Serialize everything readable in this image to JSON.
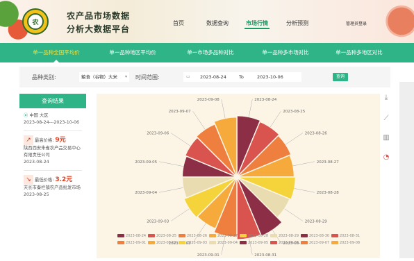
{
  "brand": {
    "line1": "农产品市场数据",
    "line2": "分析大数据平台",
    "logo_text": "农"
  },
  "nav": [
    {
      "label": "首页"
    },
    {
      "label": "数据查询"
    },
    {
      "label": "市场行情"
    },
    {
      "label": "分析预测"
    }
  ],
  "nav_active_index": 2,
  "login_label": "管理员登录",
  "subnav": [
    {
      "label": "单一品种全国平均价"
    },
    {
      "label": "单一品种地区平均价"
    },
    {
      "label": "单一市场多品种对比"
    },
    {
      "label": "单一品种多市场对比"
    },
    {
      "label": "单一品种多地区对比"
    }
  ],
  "filter": {
    "category_label": "品种类别:",
    "category_value": "粮食（谷物）大米",
    "time_label": "时间范围:",
    "date_from": "2023-08-24",
    "to_label": "To",
    "date_to": "2023-10-06",
    "search_label": "查询"
  },
  "sidebar": {
    "title": "查询结果",
    "region": "中国 大区",
    "date_range": "2023-08-24---2023-10-06",
    "max_label": "最高价格:",
    "max_value": "9元",
    "max_market": "陕西西安朱雀农产品交易中心有限责任公司",
    "max_date": "2023-08-24",
    "min_label": "最低价格:",
    "min_value": "3.2元",
    "min_market": "天长市秦栏镇农产品批发市场",
    "min_date": "2023-08-25"
  },
  "chart_data": {
    "type": "pie",
    "subtype": "rose",
    "categories": [
      "2023-08-24",
      "2023-08-25",
      "2023-08-26",
      "2023-08-27",
      "2023-08-28",
      "2023-08-29",
      "2023-08-30",
      "2023-08-31",
      "2023-09-01",
      "2023-09-02",
      "2023-09-03",
      "2023-09-04",
      "2023-09-05",
      "2023-09-06",
      "2023-09-07",
      "2023-09-08"
    ],
    "values": [
      5,
      5,
      5,
      5,
      5,
      5,
      5,
      5,
      5,
      5,
      5,
      5,
      5,
      5,
      5,
      5
    ],
    "radii": [
      0.92,
      0.9,
      0.88,
      0.86,
      0.88,
      0.86,
      0.96,
      0.94,
      0.9,
      0.84,
      0.86,
      0.82,
      0.82,
      0.84,
      0.86,
      0.9
    ],
    "colors": [
      "#8b2e46",
      "#d9534f",
      "#ee7f3e",
      "#f6aa3b",
      "#f4d43a",
      "#e8dcb0",
      "#8b2e46",
      "#d9534f",
      "#ee7f3e",
      "#f6aa3b",
      "#f4d43a",
      "#e8dcb0",
      "#8b2e46",
      "#d9534f",
      "#ee7f3e",
      "#f6aa3b"
    ],
    "legend": [
      "2023-08-24",
      "2023-08-25",
      "2023-08-26",
      "2023-08-27",
      "2023-08-28",
      "2023-08-29",
      "2023-08-30",
      "2023-08-31",
      "2023-09-01",
      "2023-09-02",
      "2023-09-03",
      "2023-09-04",
      "2023-09-05",
      "2023-09-06",
      "2023-09-07",
      "2023-09-08"
    ]
  },
  "tools": [
    "download-icon",
    "line-chart-icon",
    "bar-chart-icon",
    "pie-chart-icon"
  ],
  "colors": {
    "primary": "#2fb487",
    "active": "#f7e13b",
    "price": "#e13a1a"
  }
}
